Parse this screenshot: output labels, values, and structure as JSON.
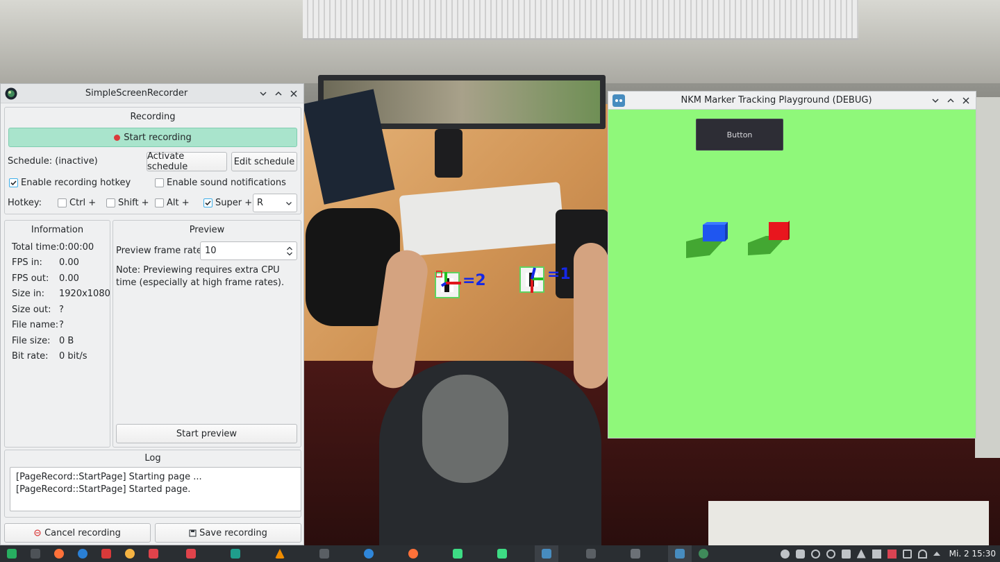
{
  "ssr": {
    "window_title": "SimpleScreenRecorder",
    "recording": {
      "group_title": "Recording",
      "start_label": "Start recording",
      "schedule_status": "Schedule: (inactive)",
      "activate_schedule_label": "Activate schedule",
      "edit_schedule_label": "Edit schedule",
      "enable_hotkey_label": "Enable recording hotkey",
      "enable_hotkey_checked": true,
      "sound_notifications_label": "Enable sound notifications",
      "sound_notifications_checked": false,
      "hotkey_label": "Hotkey:",
      "ctrl_label": "Ctrl +",
      "ctrl_checked": false,
      "shift_label": "Shift +",
      "shift_checked": false,
      "alt_label": "Alt +",
      "alt_checked": false,
      "super_label": "Super +",
      "super_checked": true,
      "key_value": "R"
    },
    "information": {
      "group_title": "Information",
      "rows": [
        {
          "key": "Total time:",
          "value": "0:00:00"
        },
        {
          "key": "FPS in:",
          "value": "0.00"
        },
        {
          "key": "FPS out:",
          "value": "0.00"
        },
        {
          "key": "Size in:",
          "value": "1920x1080"
        },
        {
          "key": "Size out:",
          "value": "?"
        },
        {
          "key": "File name:",
          "value": "?"
        },
        {
          "key": "File size:",
          "value": "0 B"
        },
        {
          "key": "Bit rate:",
          "value": "0 bit/s"
        }
      ]
    },
    "preview": {
      "group_title": "Preview",
      "frame_rate_label": "Preview frame rate:",
      "frame_rate_value": "10",
      "note": "Note: Previewing requires extra CPU time (especially at high frame rates).",
      "start_preview_label": "Start preview"
    },
    "log": {
      "group_title": "Log",
      "lines": [
        "[PageRecord::StartPage] Starting page ...",
        "[PageRecord::StartPage] Started page."
      ]
    },
    "cancel_label": "Cancel recording",
    "save_label": "Save recording"
  },
  "nkm": {
    "window_title": "NKM Marker Tracking Playground (DEBUG)",
    "button_label": "Button",
    "background_color": "#8ff87a",
    "cubes": [
      {
        "color": "#1f56f0",
        "name": "blue-cube"
      },
      {
        "color": "#e8161e",
        "name": "red-cube"
      }
    ]
  },
  "camera": {
    "marker_labels": [
      "=2",
      "=1"
    ]
  },
  "taskbar": {
    "clock": "Mi. 2  15:30"
  },
  "colors": {
    "accent": "#3daee9",
    "record_button": "#a9e4cc",
    "taskbar": "#2a2e32"
  }
}
